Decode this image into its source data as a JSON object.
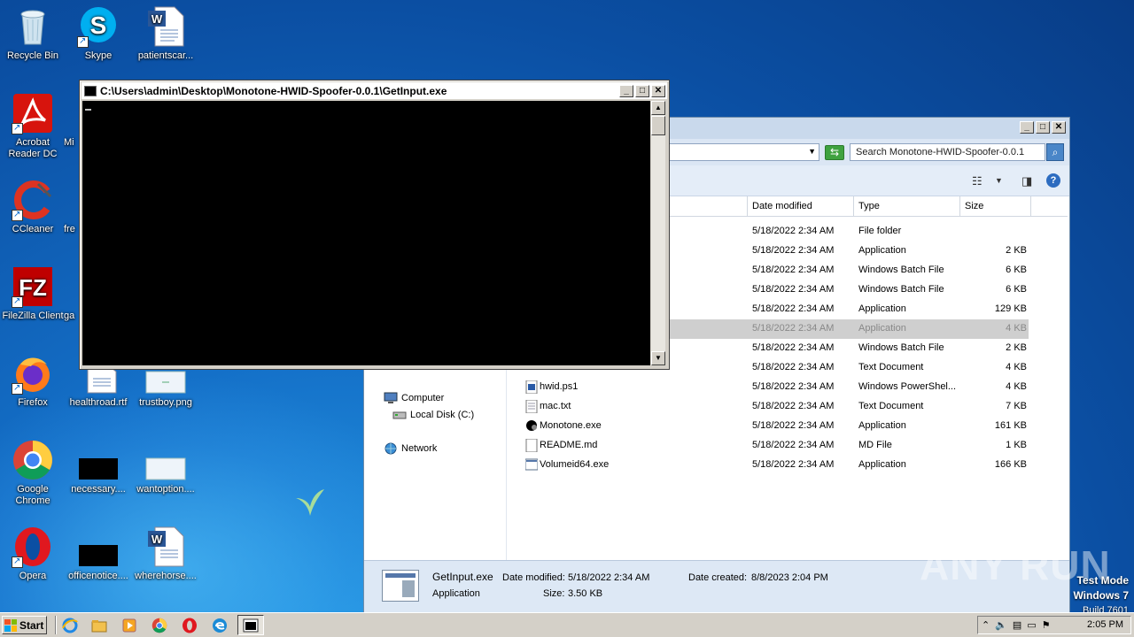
{
  "desktop": {
    "icons": [
      {
        "label": "Recycle Bin",
        "icon": "recycle-bin-icon"
      },
      {
        "label": "Skype",
        "icon": "skype-icon"
      },
      {
        "label": "patientscar...",
        "icon": "word-doc-icon"
      },
      {
        "label": "Acrobat Reader DC",
        "icon": "acrobat-icon"
      },
      {
        "label": "Mi",
        "icon": "partial-icon"
      },
      {
        "label": "CCleaner",
        "icon": "ccleaner-icon"
      },
      {
        "label": "fre",
        "icon": "partial-icon"
      },
      {
        "label": "FileZilla Client",
        "icon": "filezilla-icon"
      },
      {
        "label": "ga",
        "icon": "partial-icon"
      },
      {
        "label": "Firefox",
        "icon": "firefox-icon"
      },
      {
        "label": "healthroad.rtf",
        "icon": "word-doc-icon"
      },
      {
        "label": "trustboy.png",
        "icon": "image-file-icon"
      },
      {
        "label": "Google Chrome",
        "icon": "chrome-icon"
      },
      {
        "label": "necessary....",
        "icon": "black-file-icon"
      },
      {
        "label": "wantoption....",
        "icon": "image-file-icon"
      },
      {
        "label": "Opera",
        "icon": "opera-icon"
      },
      {
        "label": "officenotice....",
        "icon": "black-file-icon"
      },
      {
        "label": "wherehorse....",
        "icon": "word-doc-icon"
      }
    ]
  },
  "console": {
    "title": "C:\\Users\\admin\\Desktop\\Monotone-HWID-Spoofer-0.0.1\\GetInput.exe",
    "minimize": "_",
    "maximize": "□",
    "close": "✕"
  },
  "explorer": {
    "search_placeholder": "Search Monotone-HWID-Spoofer-0.0.1",
    "columns": {
      "date": "Date modified",
      "type": "Type",
      "size": "Size"
    },
    "nav": {
      "computer": "Computer",
      "local_disk": "Local Disk (C:)",
      "network": "Network"
    },
    "files": [
      {
        "name": "",
        "date": "5/18/2022 2:34 AM",
        "type": "File folder",
        "size": "",
        "icon": "folder-icon"
      },
      {
        "name": "",
        "date": "5/18/2022 2:34 AM",
        "type": "Application",
        "size": "2 KB",
        "icon": "app-icon"
      },
      {
        "name": "",
        "date": "5/18/2022 2:34 AM",
        "type": "Windows Batch File",
        "size": "6 KB",
        "icon": "batch-icon"
      },
      {
        "name": "",
        "date": "5/18/2022 2:34 AM",
        "type": "Windows Batch File",
        "size": "6 KB",
        "icon": "batch-icon"
      },
      {
        "name": "",
        "date": "5/18/2022 2:34 AM",
        "type": "Application",
        "size": "129 KB",
        "icon": "app-icon"
      },
      {
        "name": "",
        "date": "5/18/2022 2:34 AM",
        "type": "Application",
        "size": "4 KB",
        "icon": "app-icon",
        "selected": true
      },
      {
        "name": "",
        "date": "5/18/2022 2:34 AM",
        "type": "Windows Batch File",
        "size": "2 KB",
        "icon": "batch-icon"
      },
      {
        "name": "",
        "date": "5/18/2022 2:34 AM",
        "type": "Text Document",
        "size": "4 KB",
        "icon": "text-file-icon"
      },
      {
        "name": "hwid.ps1",
        "date": "5/18/2022 2:34 AM",
        "type": "Windows PowerShel...",
        "size": "4 KB",
        "icon": "powershell-icon"
      },
      {
        "name": "mac.txt",
        "date": "5/18/2022 2:34 AM",
        "type": "Text Document",
        "size": "7 KB",
        "icon": "text-file-icon"
      },
      {
        "name": "Monotone.exe",
        "date": "5/18/2022 2:34 AM",
        "type": "Application",
        "size": "161 KB",
        "icon": "monotone-icon"
      },
      {
        "name": "README.md",
        "date": "5/18/2022 2:34 AM",
        "type": "MD File",
        "size": "1 KB",
        "icon": "blank-file-icon"
      },
      {
        "name": "Volumeid64.exe",
        "date": "5/18/2022 2:34 AM",
        "type": "Application",
        "size": "166 KB",
        "icon": "app-icon"
      }
    ],
    "details": {
      "name": "GetInput.exe",
      "kind": "Application",
      "date_modified_label": "Date modified:",
      "date_modified": "5/18/2022 2:34 AM",
      "size_label": "Size:",
      "size": "3.50 KB",
      "date_created_label": "Date created:",
      "date_created": "8/8/2023 2:04 PM"
    }
  },
  "watermark": "ANY RUN",
  "test_mode": {
    "line1": "Test Mode",
    "line2": "Windows 7",
    "line3": "Build 7601"
  },
  "taskbar": {
    "start_label": "Start",
    "clock": "2:05 PM"
  }
}
